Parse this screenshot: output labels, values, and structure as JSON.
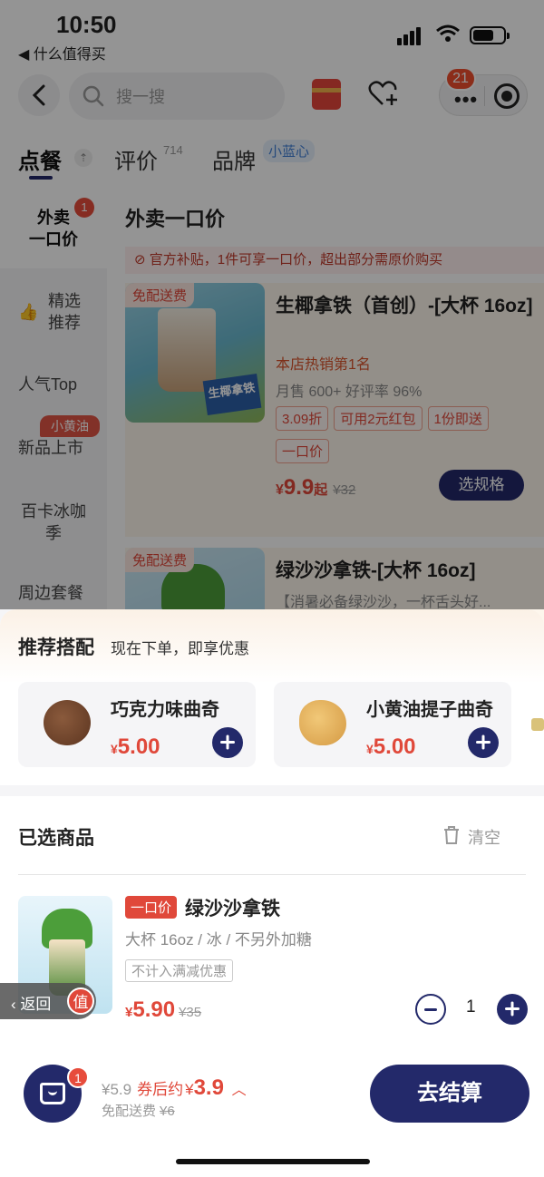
{
  "status": {
    "time": "10:50",
    "back_app": "◀ 什么值得买"
  },
  "header": {
    "search_placeholder": "搜一搜",
    "notification_count": "21"
  },
  "tabs": [
    {
      "label": "点餐"
    },
    {
      "label": "评价",
      "sup": "714"
    },
    {
      "label": "品牌",
      "tag": "小蓝心"
    }
  ],
  "sidebar": {
    "items": [
      "外卖\n一口价",
      "精选\n推荐",
      "人气Top",
      "新品上市",
      "百卡冰咖\n季",
      "周边套餐"
    ],
    "badge": "1",
    "new_tag": "小黄油"
  },
  "menu": {
    "section_title": "外卖一口价",
    "notice": "⊘ 官方补贴，1件可享一口价，超出部分需原价购买",
    "products": [
      {
        "free_tag": "免配送费",
        "name": "生椰拿铁（首创）-[大杯 16oz]",
        "hot": "本店热销第1名",
        "sales": "月售 600+ 好评率 96%",
        "chips": [
          "3.09折",
          "可用2元红包",
          "1份即送"
        ],
        "chip2": "一口价",
        "price_symbol": "¥",
        "price": "9.9",
        "price_suffix": "起",
        "old_price": "¥32",
        "button": "选规格",
        "image_text": "生椰拿铁"
      },
      {
        "free_tag": "免配送费",
        "name": "绿沙沙拿铁-[大杯 16oz]",
        "desc": "【消暑必备绿沙沙，一杯舌头好..."
      }
    ]
  },
  "recommend": {
    "title": "推荐搭配",
    "subtitle": "现在下单，即享优惠",
    "items": [
      {
        "name": "巧克力味曲奇",
        "price_symbol": "¥",
        "price": "5.00"
      },
      {
        "name": "小黄油提子曲奇",
        "price_symbol": "¥",
        "price": "5.00"
      }
    ]
  },
  "selected": {
    "title": "已选商品",
    "clear": "清空",
    "item": {
      "tag": "一口价",
      "name": "绿沙沙拿铁",
      "spec": "大杯 16oz / 冰 / 不另外加糖",
      "note": "不计入满减优惠",
      "price_symbol": "¥",
      "price": "5.90",
      "old_price": "¥35",
      "qty": "1"
    }
  },
  "float_back": {
    "label": "返回",
    "badge": "值"
  },
  "bottom": {
    "cart_count": "1",
    "original": "¥5.9",
    "after_label": "券后约",
    "after_symbol": "¥",
    "after_price": "3.9",
    "shipping": "免配送费",
    "shipping_old": "¥6",
    "checkout": "去结算"
  },
  "colors": {
    "accent": "#23296a",
    "price_red": "#e0483a",
    "badge_red": "#e74c3c"
  }
}
